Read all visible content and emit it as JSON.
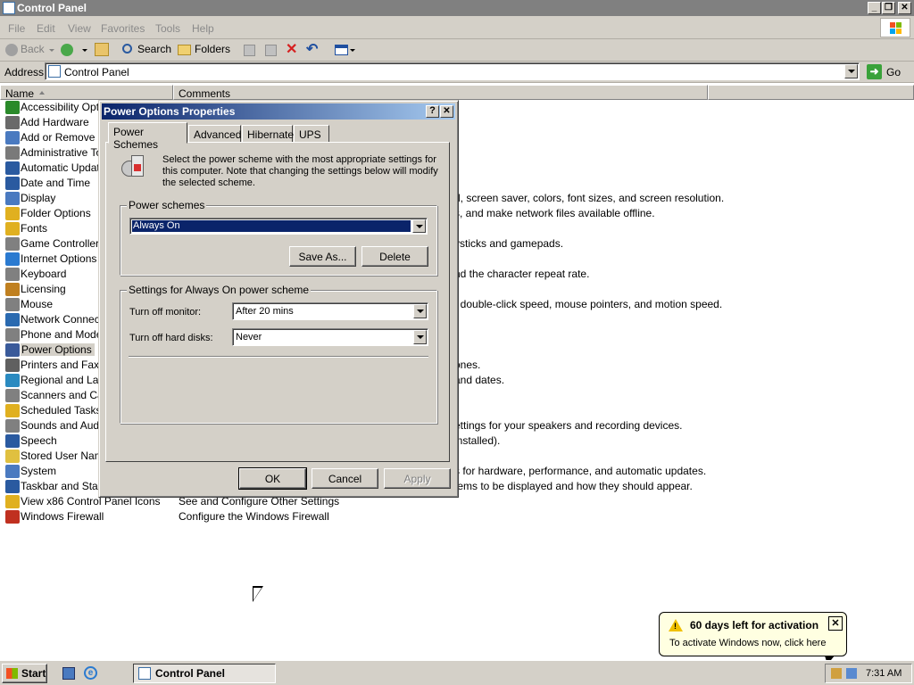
{
  "window": {
    "title": "Control Panel"
  },
  "menu": [
    "File",
    "Edit",
    "View",
    "Favorites",
    "Tools",
    "Help"
  ],
  "toolbar": {
    "back": "Back",
    "search": "Search",
    "folders": "Folders"
  },
  "address": {
    "label": "Address",
    "value": "Control Panel",
    "go": "Go"
  },
  "columns": {
    "name": "Name",
    "comments": "Comments"
  },
  "items": [
    "Accessibility Options",
    "Add Hardware",
    "Add or Remove Programs",
    "Administrative Tools",
    "Automatic Updates",
    "Date and Time",
    "Display",
    "Folder Options",
    "Fonts",
    "Game Controllers",
    "Internet Options",
    "Keyboard",
    "Licensing",
    "Mouse",
    "Network Connections",
    "Phone and Modem Options",
    "Power Options",
    "Printers and Faxes",
    "Regional and Language Options",
    "Scanners and Cameras",
    "Scheduled Tasks",
    "Sounds and Audio Devices",
    "Speech",
    "Stored User Names and Passwords",
    "System",
    "Taskbar and Start Menu",
    "View x86 Control Panel Icons",
    "Windows Firewall"
  ],
  "comments": [
    {
      "row": 6,
      "text": "d, screen saver, colors, font sizes, and screen resolution."
    },
    {
      "row": 7,
      "text": "s, and make network files available offline."
    },
    {
      "row": 9,
      "text": "ysticks and gamepads."
    },
    {
      "row": 11,
      "text": "nd the character repeat rate."
    },
    {
      "row": 13,
      "text": ", double-click speed, mouse pointers, and motion speed."
    },
    {
      "row": 17,
      "text": "ones."
    },
    {
      "row": 18,
      "text": " and dates."
    },
    {
      "row": 21,
      "text": "ettings for your speakers and recording devices."
    },
    {
      "row": 22,
      "text": " installed)."
    },
    {
      "row": 24,
      "text": "s for hardware, performance, and automatic updates."
    },
    {
      "row": 25,
      "text": "tems to be displayed and how they should appear."
    },
    {
      "row": 26,
      "text": "See and Configure Other Settings"
    },
    {
      "row": 27,
      "text": "Configure the Windows Firewall"
    }
  ],
  "dialog": {
    "title": "Power Options Properties",
    "tabs": [
      "Power Schemes",
      "Advanced",
      "Hibernate",
      "UPS"
    ],
    "description": "Select the power scheme with the most appropriate settings for this computer. Note that changing the settings below will modify the selected scheme.",
    "schemes_label": "Power schemes",
    "scheme_value": "Always On",
    "save_as": "Save As...",
    "delete": "Delete",
    "settings_label": "Settings for Always On power scheme",
    "monitor_label": "Turn off monitor:",
    "monitor_value": "After 20 mins",
    "disks_label": "Turn off hard disks:",
    "disks_value": "Never",
    "ok": "OK",
    "cancel": "Cancel",
    "apply": "Apply"
  },
  "taskbar": {
    "start": "Start",
    "task": "Control Panel",
    "clock": "7:31 AM"
  },
  "balloon": {
    "title": "60 days left for activation",
    "body": "To activate Windows now, click here"
  }
}
